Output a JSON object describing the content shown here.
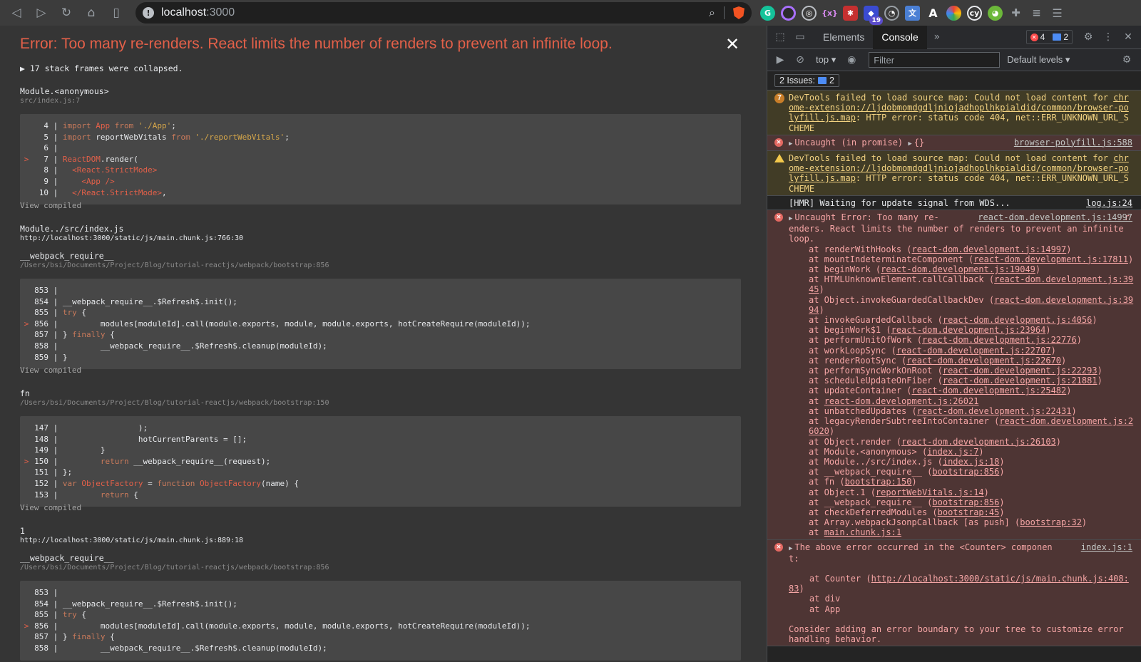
{
  "browser": {
    "url_host": "localhost",
    "url_port": ":3000",
    "extension_badge": "19"
  },
  "overlay": {
    "error_title": "Error: Too many re-renders. React limits the number of renders to prevent an infinite loop.",
    "collapsed_frames": "▶ 17 stack frames were collapsed.",
    "view_compiled": "View compiled",
    "frames": [
      {
        "title": "Module.<anonymous>",
        "source": "src/index.js:7",
        "lines": [
          {
            "n": "4",
            "mark": "",
            "html": "| <span class='kw'>import</span> <span class='tag'>App</span> <span class='kw'>from</span> <span class='str'>'./App'</span>;"
          },
          {
            "n": "5",
            "mark": "",
            "html": "| <span class='kw'>import</span> reportWebVitals <span class='kw'>from</span> <span class='str'>'./reportWebVitals'</span>;"
          },
          {
            "n": "6",
            "mark": "",
            "html": "|"
          },
          {
            "n": "7",
            "mark": ">",
            "html": "| <span class='tag'>ReactDOM</span>.render("
          },
          {
            "n": "8",
            "mark": "",
            "html": "|   <span class='tag'>&lt;React.StrictMode&gt;</span>"
          },
          {
            "n": "9",
            "mark": "",
            "html": "|     <span class='tag'>&lt;App /&gt;</span>"
          },
          {
            "n": "10",
            "mark": "",
            "html": "|   <span class='tag'>&lt;/React.StrictMode&gt;</span>,"
          }
        ]
      },
      {
        "title": "Module../src/index.js",
        "source": "http://localhost:3000/static/js/main.chunk.js:766:30"
      },
      {
        "title": "__webpack_require__",
        "source": "/Users/bsi/Documents/Project/Blog/tutorial-reactjs/webpack/bootstrap:856",
        "lines": [
          {
            "n": "853",
            "mark": "",
            "html": "|"
          },
          {
            "n": "854",
            "mark": "",
            "html": "| __webpack_require__.$Refresh$.init();"
          },
          {
            "n": "855",
            "mark": "",
            "html": "| <span class='kw'>try</span> {"
          },
          {
            "n": "856",
            "mark": ">",
            "html": "|         modules[moduleId].call(module.exports, module, module.exports, hotCreateRequire(moduleId));"
          },
          {
            "n": "857",
            "mark": "",
            "html": "| } <span class='kw'>finally</span> {"
          },
          {
            "n": "858",
            "mark": "",
            "html": "|         __webpack_require__.$Refresh$.cleanup(moduleId);"
          },
          {
            "n": "859",
            "mark": "",
            "html": "| }"
          }
        ]
      },
      {
        "title": "fn",
        "source": "/Users/bsi/Documents/Project/Blog/tutorial-reactjs/webpack/bootstrap:150",
        "lines": [
          {
            "n": "147",
            "mark": "",
            "html": "|                 );"
          },
          {
            "n": "148",
            "mark": "",
            "html": "|                 hotCurrentParents = [];"
          },
          {
            "n": "149",
            "mark": "",
            "html": "|         }"
          },
          {
            "n": "150",
            "mark": ">",
            "html": "|         <span class='kw'>return</span> __webpack_require__(request);"
          },
          {
            "n": "151",
            "mark": "",
            "html": "| };"
          },
          {
            "n": "152",
            "mark": "",
            "html": "| <span class='kw'>var</span> <span class='tag'>ObjectFactory</span> = <span class='kw'>function</span> <span class='tag'>ObjectFactory</span>(name) {"
          },
          {
            "n": "153",
            "mark": "",
            "html": "|         <span class='kw'>return</span> {"
          }
        ]
      },
      {
        "title": "1",
        "source": "http://localhost:3000/static/js/main.chunk.js:889:18"
      },
      {
        "title": "__webpack_require__",
        "source": "/Users/bsi/Documents/Project/Blog/tutorial-reactjs/webpack/bootstrap:856",
        "lines": [
          {
            "n": "853",
            "mark": "",
            "html": "|"
          },
          {
            "n": "854",
            "mark": "",
            "html": "| __webpack_require__.$Refresh$.init();"
          },
          {
            "n": "855",
            "mark": "",
            "html": "| <span class='kw'>try</span> {"
          },
          {
            "n": "856",
            "mark": ">",
            "html": "|         modules[moduleId].call(module.exports, module, module.exports, hotCreateRequire(moduleId));"
          },
          {
            "n": "857",
            "mark": "",
            "html": "| } <span class='kw'>finally</span> {"
          },
          {
            "n": "858",
            "mark": "",
            "html": "|         __webpack_require__.$Refresh$.cleanup(moduleId);"
          }
        ]
      }
    ]
  },
  "devtools": {
    "tabs": [
      "Elements",
      "Console"
    ],
    "active_tab": "Console",
    "error_count": "4",
    "message_count": "2",
    "context": "top",
    "filter_placeholder": "Filter",
    "levels": "Default levels",
    "issues_label": "2 Issues:",
    "issues_count": "2",
    "messages": [
      {
        "kind": "warn",
        "icon": "count",
        "icon_text": "7",
        "text": "DevTools failed to load source map: Could not load content for <span class='link'>chrome-extension://ljdobmomdgdljniojadhoplhkpialdid/common/browser-polyfill.js.map</span>: HTTP error: status code 404, net::ERR_UNKNOWN_URL_SCHEME"
      },
      {
        "kind": "error",
        "icon": "e",
        "icon_text": "✕",
        "text": "<span class='tri'>▶</span>Uncaught (in promise) <span class='tri'>▶</span>{}",
        "source": "browser-polyfill.js:588"
      },
      {
        "kind": "warn",
        "icon": "w",
        "icon_text": "",
        "text": "DevTools failed to load source map: Could not load content for <span class='link'>chrome-extension://ljdobmomdgdljniojadhoplhkpialdid/common/browser-polyfill.js.map</span>: HTTP error: status code 404, net::ERR_UNKNOWN_URL_SCHEME"
      },
      {
        "kind": "info",
        "icon": "",
        "icon_text": "",
        "text": "[HMR] Waiting for update signal from WDS...",
        "source": "log.js:24"
      }
    ],
    "main_error": {
      "head": "Uncaught Error: Too many re-renders. React limits the number of renders to prevent an infinite loop.",
      "source": "react-dom.development.js:14997",
      "stack": [
        [
          "renderWithHooks",
          "react-dom.development.js:14997"
        ],
        [
          "mountIndeterminateComponent",
          "react-dom.development.js:17811"
        ],
        [
          "beginWork",
          "react-dom.development.js:19049"
        ],
        [
          "HTMLUnknownElement.callCallback",
          "react-dom.development.js:3945"
        ],
        [
          "Object.invokeGuardedCallbackDev",
          "react-dom.development.js:3994"
        ],
        [
          "invokeGuardedCallback",
          "react-dom.development.js:4056"
        ],
        [
          "beginWork$1",
          "react-dom.development.js:23964"
        ],
        [
          "performUnitOfWork",
          "react-dom.development.js:22776"
        ],
        [
          "workLoopSync",
          "react-dom.development.js:22707"
        ],
        [
          "renderRootSync",
          "react-dom.development.js:22670"
        ],
        [
          "performSyncWorkOnRoot",
          "react-dom.development.js:22293"
        ],
        [
          "scheduleUpdateOnFiber",
          "react-dom.development.js:21881"
        ],
        [
          "updateContainer",
          "react-dom.development.js:25482"
        ],
        [
          "",
          "react-dom.development.js:26021"
        ],
        [
          "unbatchedUpdates",
          "react-dom.development.js:22431"
        ],
        [
          "legacyRenderSubtreeIntoContainer",
          "react-dom.development.js:26020"
        ],
        [
          "Object.render",
          "react-dom.development.js:26103"
        ],
        [
          "Module.<anonymous>",
          "index.js:7"
        ],
        [
          "Module../src/index.js",
          "index.js:18"
        ],
        [
          "__webpack_require__",
          "bootstrap:856"
        ],
        [
          "fn",
          "bootstrap:150"
        ],
        [
          "Object.1",
          "reportWebVitals.js:14"
        ],
        [
          "__webpack_require__",
          "bootstrap:856"
        ],
        [
          "checkDeferredModules",
          "bootstrap:45"
        ],
        [
          "Array.webpackJsonpCallback [as push]",
          "bootstrap:32"
        ],
        [
          "",
          "main.chunk.js:1"
        ]
      ]
    },
    "boundary_error": {
      "head": "The above error occurred in the <Counter> component:",
      "source": "index.js:1",
      "lines": [
        "",
        "    at Counter (<span class='link'>http://localhost:3000/static/js/main.chunk.js:408:83</span>)",
        "    at div",
        "    at App",
        "",
        "Consider adding an error boundary to your tree to customize error handling behavior."
      ]
    }
  }
}
